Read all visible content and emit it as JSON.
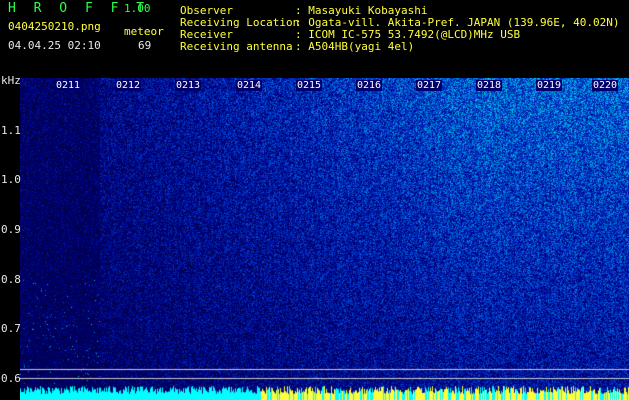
{
  "header": {
    "app_title": "H R O F F T",
    "version": "1.00",
    "filename": "0404250210.png",
    "datetime": "04.04.25 02:10",
    "meteor_label": "meteor",
    "meteor_count": "69",
    "info_labels": [
      "Observer",
      "Receiving Location",
      "Receiver",
      "Receiving antenna"
    ],
    "info_values": [
      ": Masayuki Kobayashi",
      ": Ogata-vill. Akita-Pref. JAPAN (139.96E, 40.02N)",
      ": ICOM IC-575 53.7492(@LCD)MHz USB",
      ": A504HB(yagi 4el)"
    ]
  },
  "axis": {
    "unit": "kHz",
    "y_ticks": [
      "1.1",
      "1.0",
      "0.9",
      "0.8",
      "0.7",
      "0.6"
    ],
    "time_ticks": [
      "0211",
      "0212",
      "0213",
      "0214",
      "0215",
      "0216",
      "0217",
      "0218",
      "0219",
      "0220"
    ]
  },
  "colors": {
    "background": "#000000",
    "title_green": "#2bff48",
    "label_yellow": "#ffff3a",
    "spectrum_low": "#00006a",
    "spectrum_high": "#7dff5a",
    "level_bar": "#00ffff"
  }
}
